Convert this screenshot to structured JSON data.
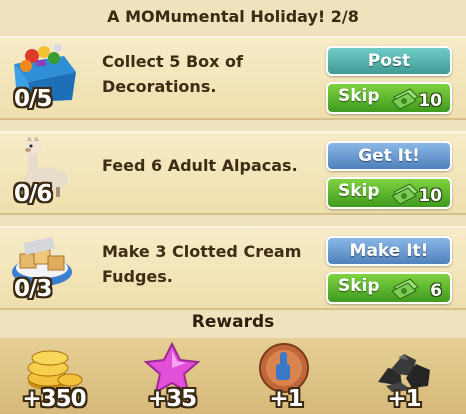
{
  "quest": {
    "title": "A MOMumental Holiday! 2/8"
  },
  "tasks": [
    {
      "description_line1": "Collect 5 Box of",
      "description_line2": "Decorations.",
      "progress": "0/5",
      "action_label": "Post",
      "skip_label": "Skip",
      "skip_cost": "10",
      "icon": "decoration-box-icon"
    },
    {
      "description_line1": "Feed 6 Adult Alpacas.",
      "description_line2": "",
      "progress": "0/6",
      "action_label": "Get It!",
      "skip_label": "Skip",
      "skip_cost": "10",
      "icon": "alpaca-icon"
    },
    {
      "description_line1": "Make 3 Clotted Cream",
      "description_line2": "Fudges.",
      "progress": "0/3",
      "action_label": "Make It!",
      "skip_label": "Skip",
      "skip_cost": "6",
      "icon": "fudge-icon"
    }
  ],
  "rewards": {
    "title": "Rewards",
    "items": [
      {
        "icon": "coins-icon",
        "amount": "+350"
      },
      {
        "icon": "xp-star-icon",
        "amount": "+35"
      },
      {
        "icon": "thumbs-up-medal-icon",
        "amount": "+1"
      },
      {
        "icon": "coal-icon",
        "amount": "+1"
      }
    ]
  },
  "colors": {
    "post_button": "#4fb0aa",
    "get_button": "#5f8fca",
    "skip_button": "#4fae26",
    "background": "#efe3bd"
  }
}
